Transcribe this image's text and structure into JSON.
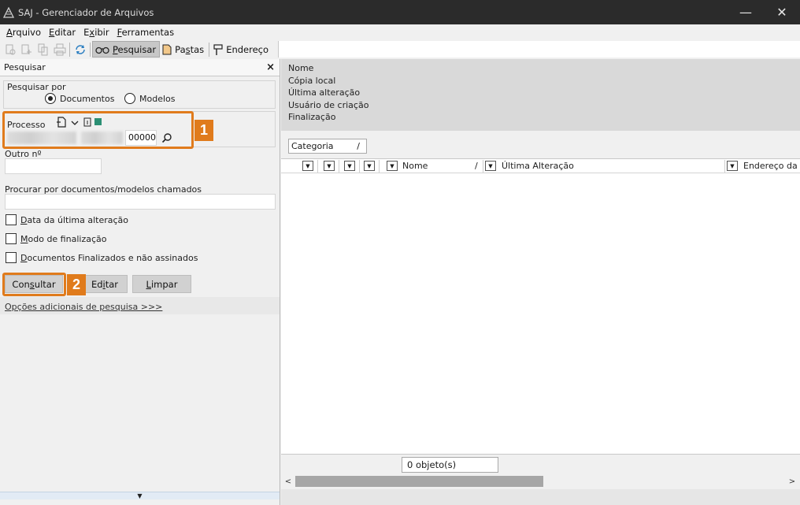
{
  "window": {
    "title": "SAJ - Gerenciador de Arquivos",
    "minimize_glyph": "—",
    "close_glyph": "✕"
  },
  "menu": [
    {
      "pre": "",
      "key": "A",
      "post": "rquivo"
    },
    {
      "pre": "",
      "key": "E",
      "post": "ditar"
    },
    {
      "pre": "E",
      "key": "x",
      "post": "ibir"
    },
    {
      "pre": "",
      "key": "F",
      "post": "erramentas"
    }
  ],
  "toolbar": {
    "search_pre": "",
    "search_key": "P",
    "search_post": "esquisar",
    "folders_pre": "Pa",
    "folders_key": "s",
    "folders_post": "tas",
    "address_label": "Endereço"
  },
  "search_panel": {
    "title": "Pesquisar",
    "close_glyph": "×",
    "search_by_label": "Pesquisar por",
    "opt_documents": "Documentos",
    "opt_models": "Modelos",
    "process_label": "Processo",
    "process_suffix": "00000",
    "other_number_label": "Outro nº",
    "search_named_label": "Procurar por documentos/modelos chamados",
    "check_last_change": {
      "key": "D",
      "rest": "ata da última alteração"
    },
    "check_finalization": {
      "key": "M",
      "rest": "odo de finalização"
    },
    "check_finalized": {
      "key": "D",
      "rest": "ocumentos Finalizados e não assinados"
    },
    "btn_consult": {
      "pre": "Con",
      "key": "s",
      "post": "ultar"
    },
    "btn_edit": {
      "pre": "Ed",
      "key": "i",
      "post": "tar"
    },
    "btn_clear": {
      "pre": "",
      "key": "L",
      "post": "impar"
    },
    "advanced_link": "Opções adicionais de pesquisa >>>",
    "callout_1": "1",
    "callout_2": "2",
    "bottom_arrow": "▼"
  },
  "details": {
    "fields": [
      "Nome",
      "Cópia local",
      "Última alteração",
      "Usuário de criação",
      "Finalização"
    ]
  },
  "grid": {
    "group_chip": "Categoria",
    "group_chip_glyph": "/",
    "col_name": "Nome",
    "col_name_glyph": "/",
    "col_last_change": "Última Alteração",
    "col_address": "Endereço da C",
    "dropdown_glyph": "▼"
  },
  "status": {
    "count": "0 objeto(s)"
  },
  "scroll": {
    "left": "<",
    "right": ">"
  },
  "colors": {
    "accent_orange": "#e07b1c",
    "titlebar_bg": "#2b2b2b"
  }
}
